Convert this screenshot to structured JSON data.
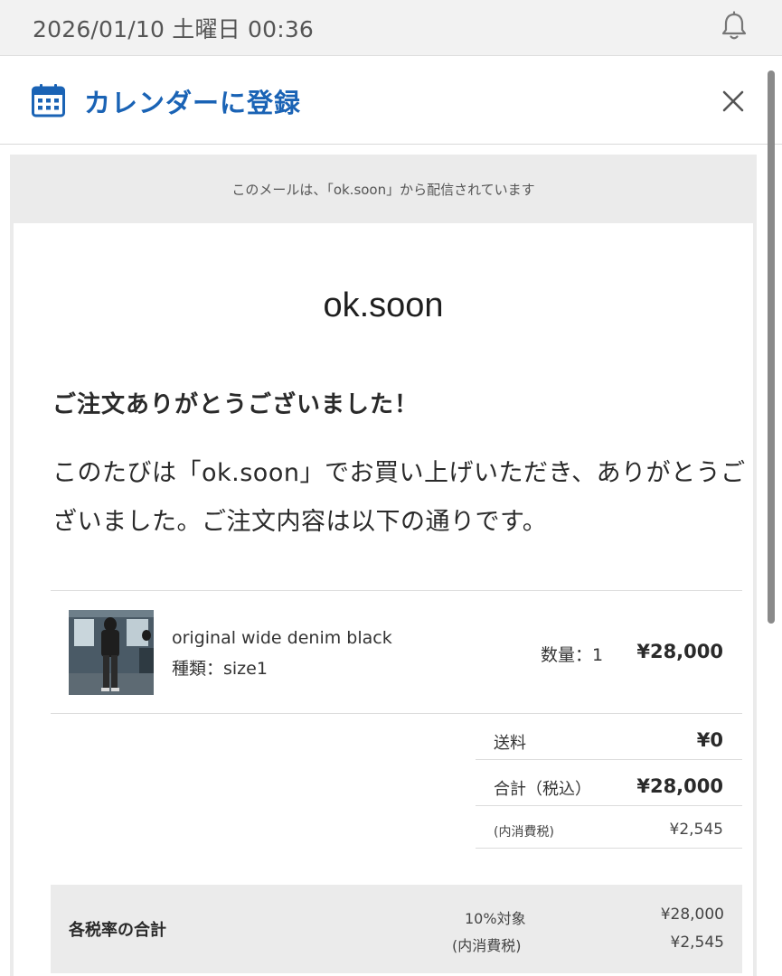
{
  "status_bar": {
    "datetime": "2026/01/10 土曜日 00:36",
    "bell_icon": "bell-icon"
  },
  "header": {
    "title": "カレンダーに登録",
    "calendar_icon": "calendar-icon",
    "close_icon": "close-icon",
    "accent_color": "#1a63b5"
  },
  "email": {
    "notice": "このメールは、「ok.soon」から配信されています",
    "brand": "ok.soon",
    "heading": "ご注文ありがとうございました！",
    "intro": "このたびは「ok.soon」でお買い上げいただき、ありがとうございました。ご注文内容は以下の通りです。",
    "item": {
      "name": "original wide denim black",
      "variant": "種類：size1",
      "quantity": "数量：1",
      "price": "¥28,000"
    },
    "summary": {
      "shipping_label": "送料",
      "shipping_value": "¥0",
      "total_label": "合計（税込）",
      "total_value": "¥28,000",
      "tax_label": "(内消費税)",
      "tax_value": "¥2,545"
    },
    "tax_rates": {
      "title": "各税率の合計",
      "rate_label": "10%対象",
      "rate_value": "¥28,000",
      "tax_label": "(内消費税)",
      "tax_value": "¥2,545"
    }
  }
}
